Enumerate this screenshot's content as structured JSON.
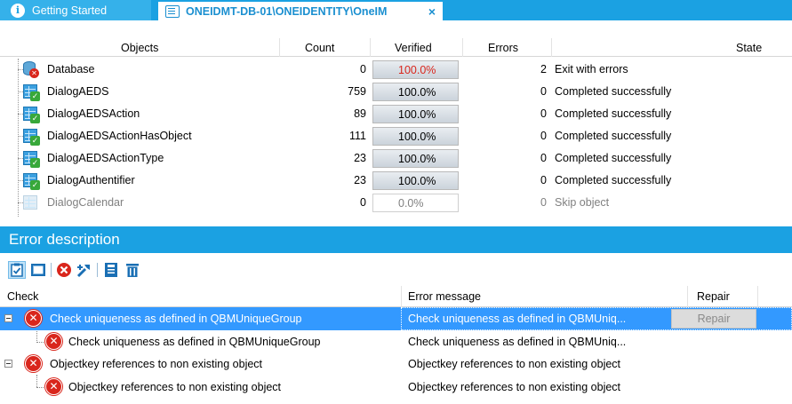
{
  "tabs": [
    {
      "label": "Getting Started",
      "icon": "info-icon"
    },
    {
      "label": "ONEIDMT-DB-01\\ONEIDENTITY\\OneIM",
      "icon": "checklist-icon",
      "close": "×"
    }
  ],
  "grid": {
    "columns": {
      "objects": "Objects",
      "count": "Count",
      "verified": "Verified",
      "errors": "Errors",
      "state": "State"
    },
    "rows": [
      {
        "name": "Database",
        "count": "0",
        "verified": "100.0%",
        "errors": "2",
        "state": "Exit with errors",
        "icon": "database-error-icon"
      },
      {
        "name": "DialogAEDS",
        "count": "759",
        "verified": "100.0%",
        "errors": "0",
        "state": "Completed successfully",
        "icon": "table-check-icon"
      },
      {
        "name": "DialogAEDSAction",
        "count": "89",
        "verified": "100.0%",
        "errors": "0",
        "state": "Completed successfully",
        "icon": "table-check-icon"
      },
      {
        "name": "DialogAEDSActionHasObject",
        "count": "111",
        "verified": "100.0%",
        "errors": "0",
        "state": "Completed successfully",
        "icon": "table-check-icon"
      },
      {
        "name": "DialogAEDSActionType",
        "count": "23",
        "verified": "100.0%",
        "errors": "0",
        "state": "Completed successfully",
        "icon": "table-check-icon"
      },
      {
        "name": "DialogAuthentifier",
        "count": "23",
        "verified": "100.0%",
        "errors": "0",
        "state": "Completed successfully",
        "icon": "table-check-icon"
      },
      {
        "name": "DialogCalendar",
        "count": "0",
        "verified": "0.0%",
        "errors": "0",
        "state": "Skip object",
        "icon": "table-icon"
      }
    ]
  },
  "error_section": {
    "title": "Error description",
    "toolbar": [
      "select-all-icon",
      "select-box-icon",
      "delete-error-icon",
      "repair-icon",
      "save-icon",
      "trash-icon"
    ],
    "columns": {
      "check": "Check",
      "error_message": "Error message",
      "repair": "Repair"
    },
    "rows": [
      {
        "check": "Check uniqueness as defined in QBMUniqueGroup",
        "message": "Check uniqueness as defined in QBMUniq...",
        "repair": "Repair",
        "level": 0,
        "selected": true
      },
      {
        "check": "Check uniqueness as defined in QBMUniqueGroup",
        "message": "Check uniqueness as defined in QBMUniq...",
        "level": 1
      },
      {
        "check": "Objectkey references to non existing object",
        "message": "Objectkey references to non existing object",
        "level": 0
      },
      {
        "check": "Objectkey references to non existing object",
        "message": "Objectkey references to non existing object",
        "level": 1
      }
    ]
  }
}
